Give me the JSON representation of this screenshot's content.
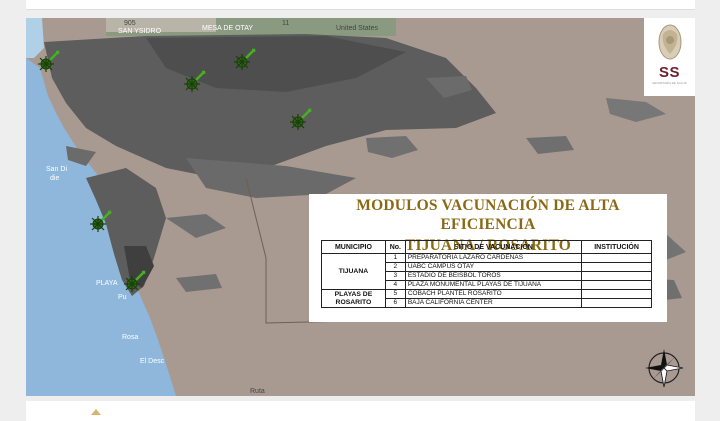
{
  "map": {
    "labels": {
      "san_ysidro": "SAN YSIDRO",
      "mesa_de_otay": "MESA DE OTAY",
      "highway_905": "905",
      "highway_11": "11",
      "united_states": "United States",
      "san_diego": "San Di",
      "san_diego_2": "die",
      "playas": "PLAYA",
      "puerto": "Pu",
      "rosarito": "Rosa",
      "el_descanso": "El Desc",
      "ruta": "Ruta"
    }
  },
  "logo": {
    "text": "SS",
    "sub": "SECRETARÍA DE SALUD"
  },
  "card": {
    "title_line1": "MODULOS VACUNACIÓN DE ALTA EFICIENCIA",
    "title_line2": "TIJUANA / ROSARITO",
    "columns": [
      "MUNICIPIO",
      "No.",
      "SITIO DE VACUNACIÓN",
      "INSTITUCIÓN"
    ],
    "groups": [
      {
        "municipio": "TIJUANA",
        "rows": [
          {
            "no": "1",
            "sitio": "PREPARATORIA LÁZARO CARDENAS",
            "institucion": ""
          },
          {
            "no": "2",
            "sitio": "UABC CAMPUS OTAY",
            "institucion": ""
          },
          {
            "no": "3",
            "sitio": "ESTADIO DE BEISBOL TOROS",
            "institucion": ""
          },
          {
            "no": "4",
            "sitio": "PLAZA MONUMENTAL PLAYAS DE TIJUANA",
            "institucion": ""
          }
        ]
      },
      {
        "municipio_line1": "PLAYAS DE",
        "municipio_line2": "ROSARITO",
        "rows": [
          {
            "no": "5",
            "sitio": "COBACH PLANTEL ROSARITO",
            "institucion": ""
          },
          {
            "no": "6",
            "sitio": "BAJA CALIFORNIA CENTER",
            "institucion": ""
          }
        ]
      }
    ]
  },
  "colors": {
    "land": "#a99a91",
    "urban": "#5a5a5a",
    "ocean": "#8fb7dc",
    "title_gold": "#8b6914",
    "pin_green": "#3a8f1e",
    "logo_burgundy": "#6b1e2e"
  },
  "icons": {
    "pins": [
      "virus-pin-icon",
      "virus-pin-icon",
      "virus-pin-icon",
      "virus-pin-icon",
      "virus-pin-icon",
      "virus-pin-icon"
    ],
    "compass": "compass-rose-icon",
    "logo": "coat-of-arms-icon"
  }
}
